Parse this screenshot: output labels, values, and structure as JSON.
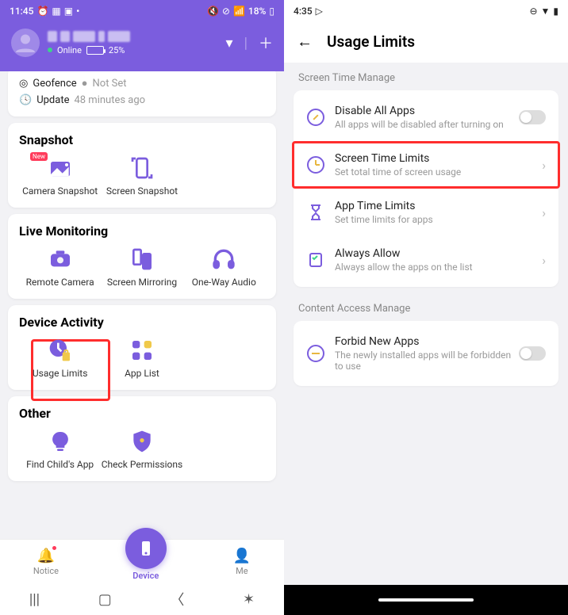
{
  "left": {
    "status": {
      "time": "11:45",
      "battery": "18%"
    },
    "header": {
      "online_label": "Online",
      "battery_pct": "25%"
    },
    "info": {
      "geofence_label": "Geofence",
      "geofence_status": "Not Set",
      "update_label": "Update",
      "update_ago": "48 minutes ago"
    },
    "sections": {
      "snapshot": {
        "title": "Snapshot",
        "tiles": [
          {
            "label": "Camera Snapshot",
            "badge": "New"
          },
          {
            "label": "Screen Snapshot"
          }
        ]
      },
      "live": {
        "title": "Live Monitoring",
        "tiles": [
          {
            "label": "Remote Camera"
          },
          {
            "label": "Screen Mirroring"
          },
          {
            "label": "One-Way Audio"
          }
        ]
      },
      "activity": {
        "title": "Device Activity",
        "tiles": [
          {
            "label": "Usage Limits"
          },
          {
            "label": "App List"
          }
        ]
      },
      "other": {
        "title": "Other",
        "tiles": [
          {
            "label": "Find Child's App"
          },
          {
            "label": "Check Permissions"
          }
        ]
      }
    },
    "nav": {
      "notice": "Notice",
      "device": "Device",
      "me": "Me"
    }
  },
  "right": {
    "status": {
      "time": "4:35"
    },
    "title": "Usage Limits",
    "sec1": {
      "label": "Screen Time Manage",
      "rows": [
        {
          "title": "Disable All Apps",
          "sub": "All apps will be disabled after turning on",
          "toggle": false
        },
        {
          "title": "Screen Time Limits",
          "sub": "Set total time of screen usage",
          "chev": true,
          "highlight": true
        },
        {
          "title": "App Time Limits",
          "sub": "Set time limits for apps",
          "chev": true
        },
        {
          "title": "Always Allow",
          "sub": "Always allow the apps on the list",
          "chev": true
        }
      ]
    },
    "sec2": {
      "label": "Content Access Manage",
      "rows": [
        {
          "title": "Forbid New Apps",
          "sub": "The newly installed apps will be forbidden to use",
          "toggle": false
        }
      ]
    }
  }
}
